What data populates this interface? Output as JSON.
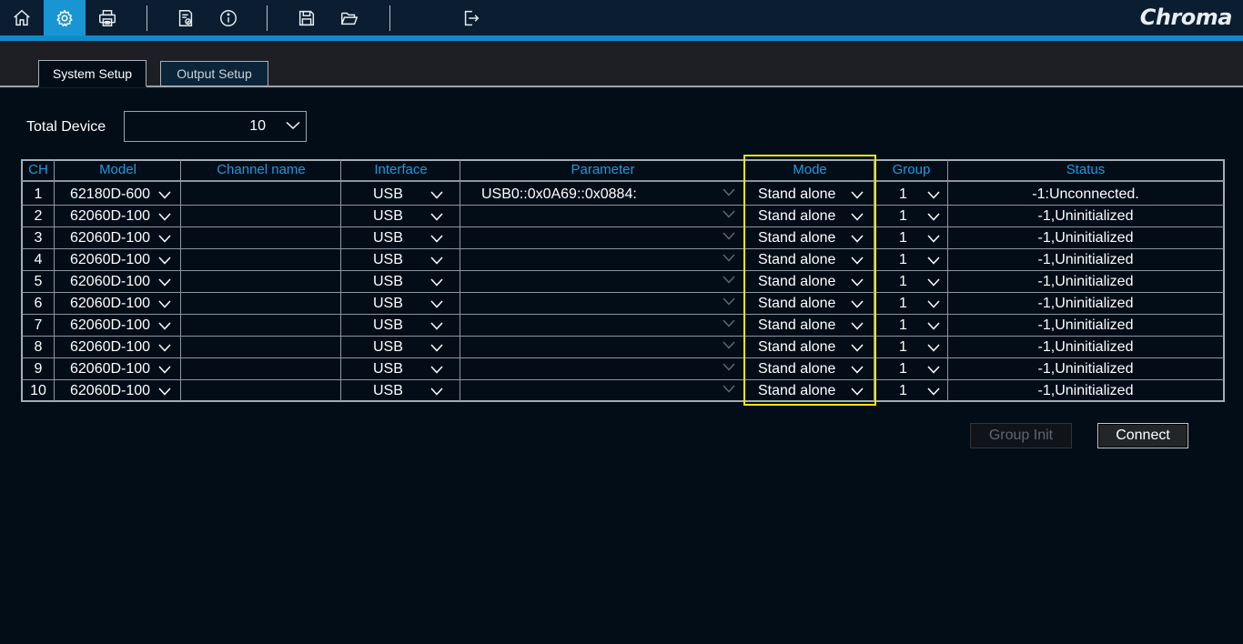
{
  "toolbar": {
    "buttons": [
      {
        "icon": "home-icon"
      },
      {
        "icon": "gear-icon",
        "active": true
      },
      {
        "icon": "printer-icon"
      },
      {
        "icon": "report-icon"
      },
      {
        "icon": "info-icon"
      },
      {
        "icon": "save-icon"
      },
      {
        "icon": "folder-open-icon"
      },
      {
        "icon": "exit-icon"
      }
    ],
    "accent": "#1189c9",
    "logo": "Chroma"
  },
  "tabs": [
    {
      "label": "System Setup",
      "active": true
    },
    {
      "label": "Output Setup",
      "active": false
    }
  ],
  "total_device": {
    "label": "Total Device",
    "value": "10"
  },
  "table": {
    "headers": {
      "ch": "CH",
      "model": "Model",
      "channel_name": "Channel name",
      "interface": "Interface",
      "parameter": "Parameter",
      "mode": "Mode",
      "group": "Group",
      "status": "Status"
    },
    "rows": [
      {
        "ch": "1",
        "model": "62180D-600",
        "channel_name": "",
        "interface": "USB",
        "parameter": "USB0::0x0A69::0x0884:",
        "mode": "Stand alone",
        "group": "1",
        "status": "-1:Unconnected."
      },
      {
        "ch": "2",
        "model": "62060D-100",
        "channel_name": "",
        "interface": "USB",
        "parameter": "",
        "mode": "Stand alone",
        "group": "1",
        "status": "-1,Uninitialized"
      },
      {
        "ch": "3",
        "model": "62060D-100",
        "channel_name": "",
        "interface": "USB",
        "parameter": "",
        "mode": "Stand alone",
        "group": "1",
        "status": "-1,Uninitialized"
      },
      {
        "ch": "4",
        "model": "62060D-100",
        "channel_name": "",
        "interface": "USB",
        "parameter": "",
        "mode": "Stand alone",
        "group": "1",
        "status": "-1,Uninitialized"
      },
      {
        "ch": "5",
        "model": "62060D-100",
        "channel_name": "",
        "interface": "USB",
        "parameter": "",
        "mode": "Stand alone",
        "group": "1",
        "status": "-1,Uninitialized"
      },
      {
        "ch": "6",
        "model": "62060D-100",
        "channel_name": "",
        "interface": "USB",
        "parameter": "",
        "mode": "Stand alone",
        "group": "1",
        "status": "-1,Uninitialized"
      },
      {
        "ch": "7",
        "model": "62060D-100",
        "channel_name": "",
        "interface": "USB",
        "parameter": "",
        "mode": "Stand alone",
        "group": "1",
        "status": "-1,Uninitialized"
      },
      {
        "ch": "8",
        "model": "62060D-100",
        "channel_name": "",
        "interface": "USB",
        "parameter": "",
        "mode": "Stand alone",
        "group": "1",
        "status": "-1,Uninitialized"
      },
      {
        "ch": "9",
        "model": "62060D-100",
        "channel_name": "",
        "interface": "USB",
        "parameter": "",
        "mode": "Stand alone",
        "group": "1",
        "status": "-1,Uninitialized"
      },
      {
        "ch": "10",
        "model": "62060D-100",
        "channel_name": "",
        "interface": "USB",
        "parameter": "",
        "mode": "Stand alone",
        "group": "1",
        "status": "-1,Uninitialized"
      }
    ]
  },
  "buttons": {
    "group_init": "Group Init",
    "connect": "Connect"
  },
  "colors": {
    "header_text": "#1b9be0",
    "highlight": "#f2e600",
    "background": "#020d18"
  }
}
